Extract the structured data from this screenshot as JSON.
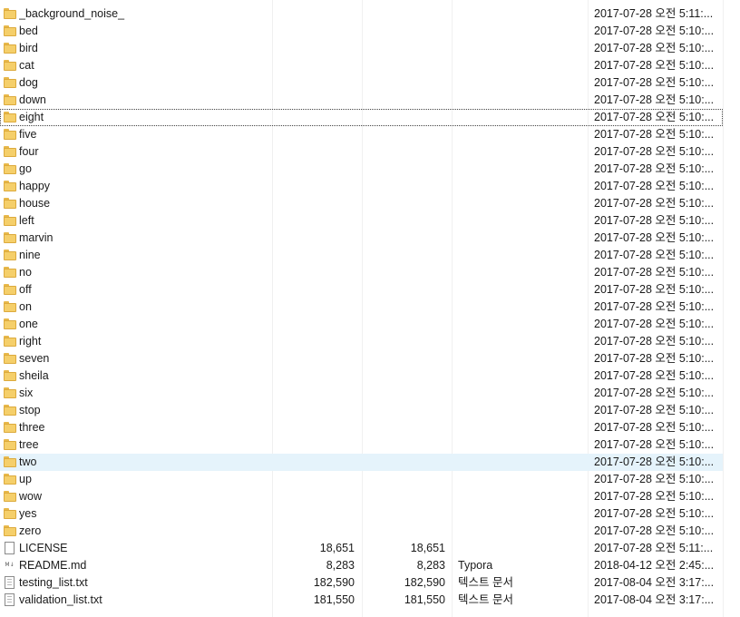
{
  "files": [
    {
      "name": "_background_noise_",
      "icon": "folder-icon",
      "size1": "",
      "size2": "",
      "type": "",
      "date": "2017-07-28 오전 5:11:..."
    },
    {
      "name": "bed",
      "icon": "folder-icon",
      "size1": "",
      "size2": "",
      "type": "",
      "date": "2017-07-28 오전 5:10:..."
    },
    {
      "name": "bird",
      "icon": "folder-icon",
      "size1": "",
      "size2": "",
      "type": "",
      "date": "2017-07-28 오전 5:10:..."
    },
    {
      "name": "cat",
      "icon": "folder-icon",
      "size1": "",
      "size2": "",
      "type": "",
      "date": "2017-07-28 오전 5:10:..."
    },
    {
      "name": "dog",
      "icon": "folder-icon",
      "size1": "",
      "size2": "",
      "type": "",
      "date": "2017-07-28 오전 5:10:..."
    },
    {
      "name": "down",
      "icon": "folder-icon",
      "size1": "",
      "size2": "",
      "type": "",
      "date": "2017-07-28 오전 5:10:..."
    },
    {
      "name": "eight",
      "icon": "folder-icon",
      "size1": "",
      "size2": "",
      "type": "",
      "date": "2017-07-28 오전 5:10:...",
      "state": "focus"
    },
    {
      "name": "five",
      "icon": "folder-icon",
      "size1": "",
      "size2": "",
      "type": "",
      "date": "2017-07-28 오전 5:10:..."
    },
    {
      "name": "four",
      "icon": "folder-icon",
      "size1": "",
      "size2": "",
      "type": "",
      "date": "2017-07-28 오전 5:10:..."
    },
    {
      "name": "go",
      "icon": "folder-icon",
      "size1": "",
      "size2": "",
      "type": "",
      "date": "2017-07-28 오전 5:10:..."
    },
    {
      "name": "happy",
      "icon": "folder-icon",
      "size1": "",
      "size2": "",
      "type": "",
      "date": "2017-07-28 오전 5:10:..."
    },
    {
      "name": "house",
      "icon": "folder-icon",
      "size1": "",
      "size2": "",
      "type": "",
      "date": "2017-07-28 오전 5:10:..."
    },
    {
      "name": "left",
      "icon": "folder-icon",
      "size1": "",
      "size2": "",
      "type": "",
      "date": "2017-07-28 오전 5:10:..."
    },
    {
      "name": "marvin",
      "icon": "folder-icon",
      "size1": "",
      "size2": "",
      "type": "",
      "date": "2017-07-28 오전 5:10:..."
    },
    {
      "name": "nine",
      "icon": "folder-icon",
      "size1": "",
      "size2": "",
      "type": "",
      "date": "2017-07-28 오전 5:10:..."
    },
    {
      "name": "no",
      "icon": "folder-icon",
      "size1": "",
      "size2": "",
      "type": "",
      "date": "2017-07-28 오전 5:10:..."
    },
    {
      "name": "off",
      "icon": "folder-icon",
      "size1": "",
      "size2": "",
      "type": "",
      "date": "2017-07-28 오전 5:10:..."
    },
    {
      "name": "on",
      "icon": "folder-icon",
      "size1": "",
      "size2": "",
      "type": "",
      "date": "2017-07-28 오전 5:10:..."
    },
    {
      "name": "one",
      "icon": "folder-icon",
      "size1": "",
      "size2": "",
      "type": "",
      "date": "2017-07-28 오전 5:10:..."
    },
    {
      "name": "right",
      "icon": "folder-icon",
      "size1": "",
      "size2": "",
      "type": "",
      "date": "2017-07-28 오전 5:10:..."
    },
    {
      "name": "seven",
      "icon": "folder-icon",
      "size1": "",
      "size2": "",
      "type": "",
      "date": "2017-07-28 오전 5:10:..."
    },
    {
      "name": "sheila",
      "icon": "folder-icon",
      "size1": "",
      "size2": "",
      "type": "",
      "date": "2017-07-28 오전 5:10:..."
    },
    {
      "name": "six",
      "icon": "folder-icon",
      "size1": "",
      "size2": "",
      "type": "",
      "date": "2017-07-28 오전 5:10:..."
    },
    {
      "name": "stop",
      "icon": "folder-icon",
      "size1": "",
      "size2": "",
      "type": "",
      "date": "2017-07-28 오전 5:10:..."
    },
    {
      "name": "three",
      "icon": "folder-icon",
      "size1": "",
      "size2": "",
      "type": "",
      "date": "2017-07-28 오전 5:10:..."
    },
    {
      "name": "tree",
      "icon": "folder-icon",
      "size1": "",
      "size2": "",
      "type": "",
      "date": "2017-07-28 오전 5:10:..."
    },
    {
      "name": "two",
      "icon": "folder-icon",
      "size1": "",
      "size2": "",
      "type": "",
      "date": "2017-07-28 오전 5:10:...",
      "state": "hover"
    },
    {
      "name": "up",
      "icon": "folder-icon",
      "size1": "",
      "size2": "",
      "type": "",
      "date": "2017-07-28 오전 5:10:..."
    },
    {
      "name": "wow",
      "icon": "folder-icon",
      "size1": "",
      "size2": "",
      "type": "",
      "date": "2017-07-28 오전 5:10:..."
    },
    {
      "name": "yes",
      "icon": "folder-icon",
      "size1": "",
      "size2": "",
      "type": "",
      "date": "2017-07-28 오전 5:10:..."
    },
    {
      "name": "zero",
      "icon": "folder-icon",
      "size1": "",
      "size2": "",
      "type": "",
      "date": "2017-07-28 오전 5:10:..."
    },
    {
      "name": "LICENSE",
      "icon": "blank-file-icon",
      "size1": "18,651",
      "size2": "18,651",
      "type": "",
      "date": "2017-07-28 오전 5:11:..."
    },
    {
      "name": "README.md",
      "icon": "markdown-file-icon",
      "size1": "8,283",
      "size2": "8,283",
      "type": "Typora",
      "date": "2018-04-12 오전 2:45:..."
    },
    {
      "name": "testing_list.txt",
      "icon": "text-file-icon",
      "size1": "182,590",
      "size2": "182,590",
      "type": "텍스트 문서",
      "date": "2017-08-04 오전 3:17:..."
    },
    {
      "name": "validation_list.txt",
      "icon": "text-file-icon",
      "size1": "181,550",
      "size2": "181,550",
      "type": "텍스트 문서",
      "date": "2017-08-04 오전 3:17:..."
    }
  ],
  "colors": {
    "hover_row": "#e5f3fb",
    "folder": "#f5cf6a",
    "gridline": "#f0f0f0"
  }
}
